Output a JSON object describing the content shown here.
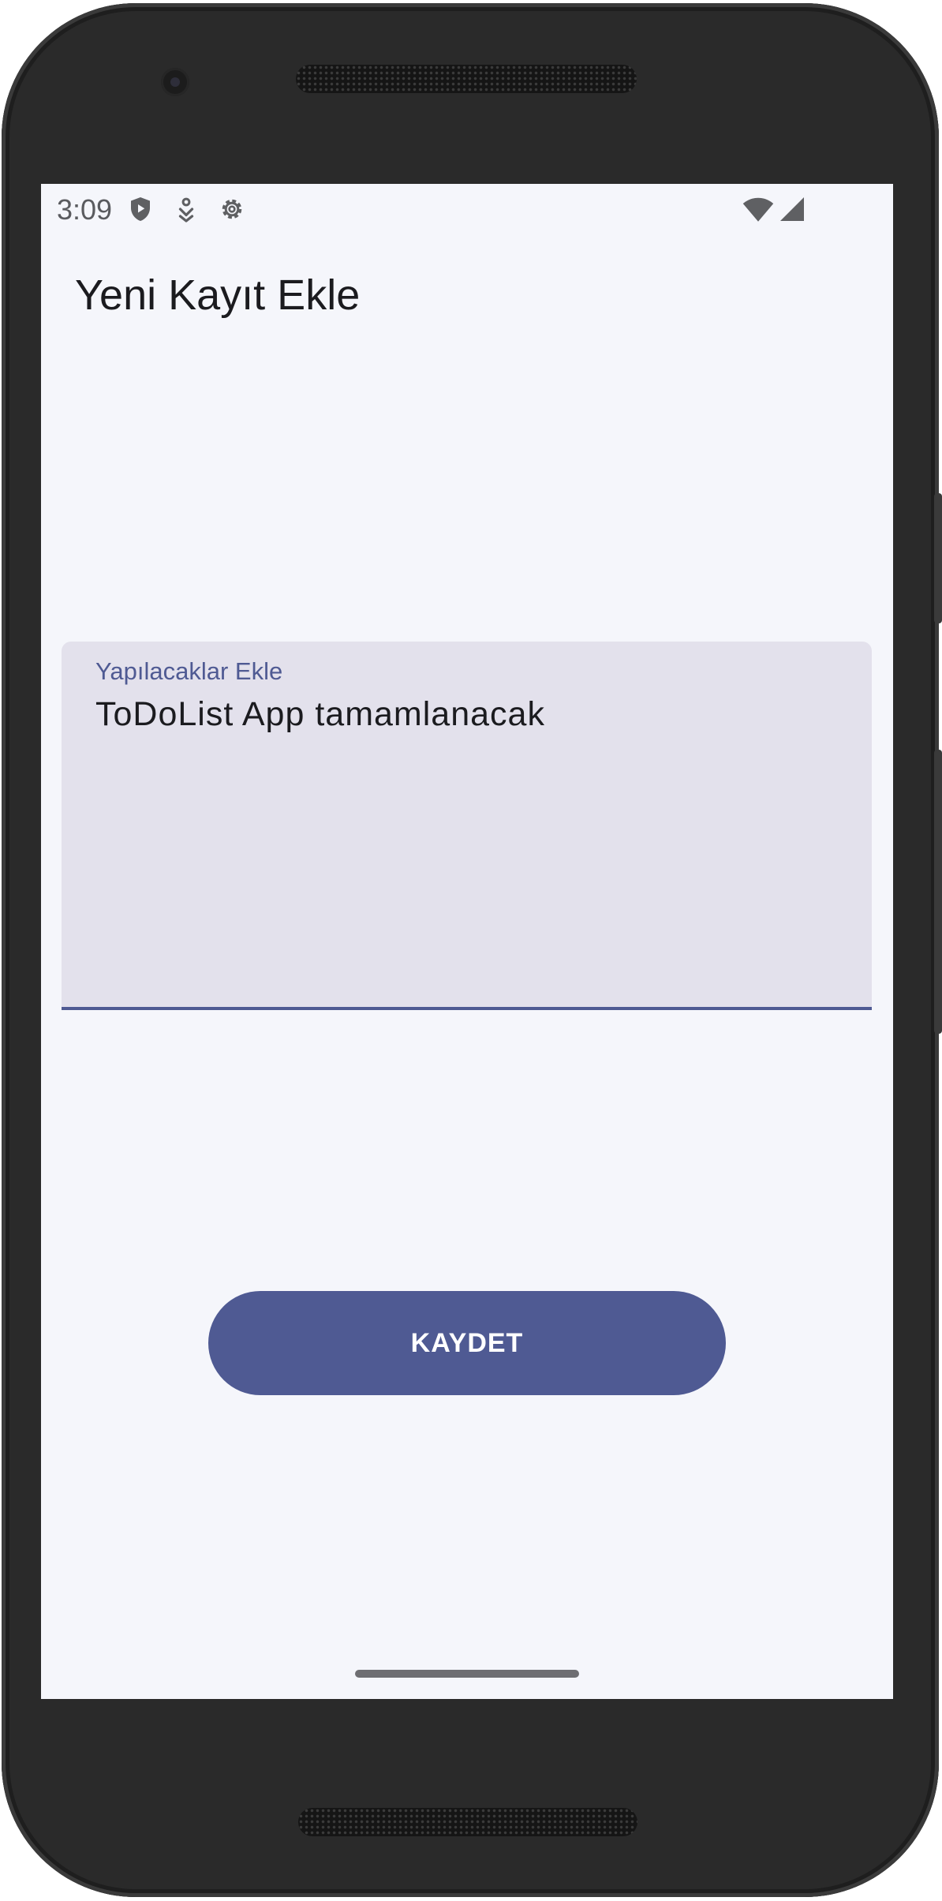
{
  "status_bar": {
    "time": "3:09",
    "icons": [
      "shield-play-icon",
      "download-person-icon",
      "gear-icon",
      "wifi-icon",
      "cell-signal-icon"
    ]
  },
  "header": {
    "title": "Yeni Kayıt Ekle"
  },
  "form": {
    "todo_field": {
      "label": "Yapılacaklar Ekle",
      "value": "ToDoList App tamamlanacak"
    },
    "save_label": "KAYDET"
  },
  "colors": {
    "accent": "#4f5a93",
    "field_background": "#e3e1ec",
    "screen_background": "#f5f6fb",
    "text_primary": "#1b1b1f"
  }
}
